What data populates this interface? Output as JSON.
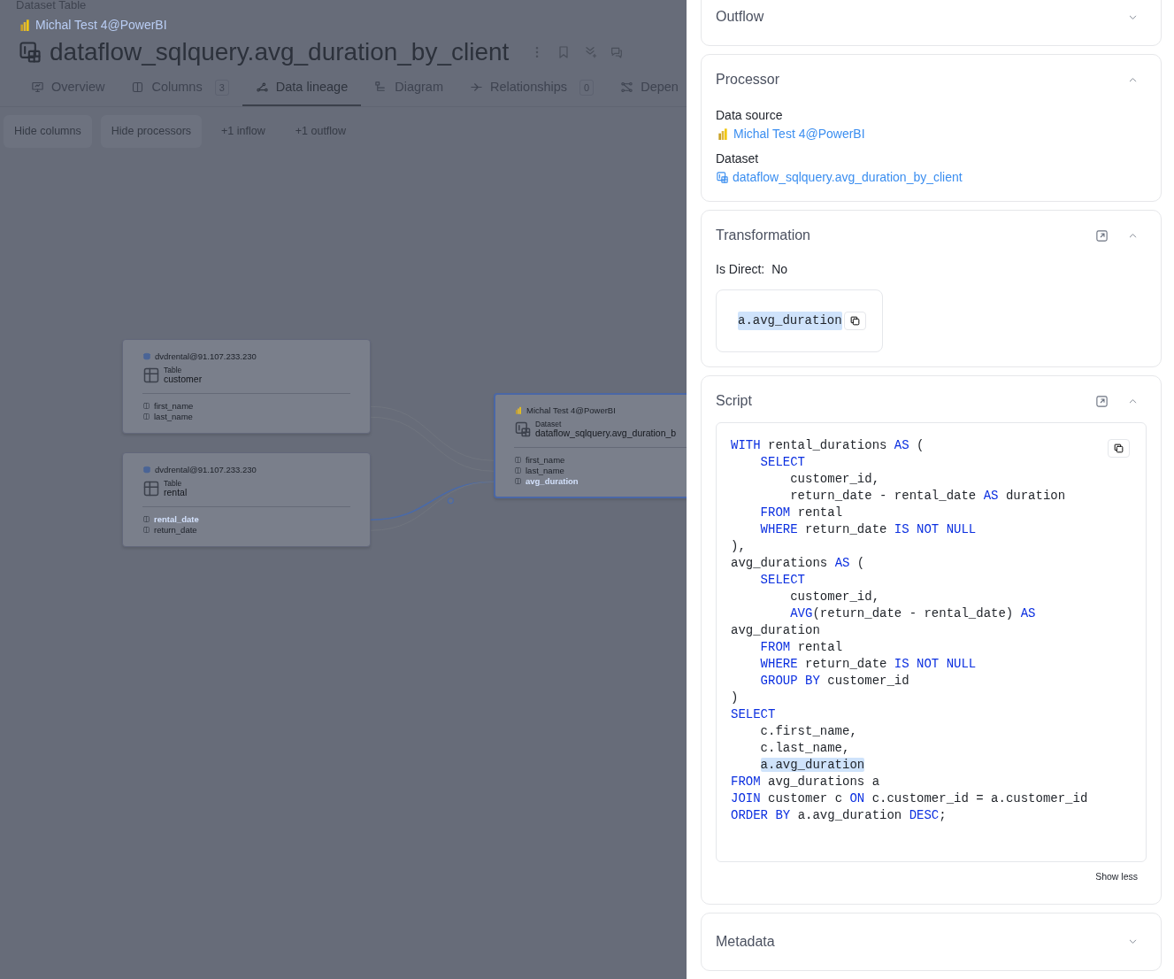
{
  "header": {
    "breadcrumb": "Dataset Table",
    "source": "Michal Test 4@PowerBI",
    "title": "dataflow_sqlquery.avg_duration_by_client"
  },
  "tabs": [
    {
      "label": "Overview",
      "selected": false
    },
    {
      "label": "Columns",
      "count": "3",
      "selected": false
    },
    {
      "label": "Data lineage",
      "selected": true
    },
    {
      "label": "Diagram",
      "selected": false
    },
    {
      "label": "Relationships",
      "count": "0",
      "selected": false
    },
    {
      "label": "Depen",
      "selected": false
    }
  ],
  "toolbar_buttons": [
    "Hide columns",
    "Hide processors",
    "+1 inflow",
    "+1 outflow"
  ],
  "lineage": {
    "nodes": [
      {
        "kind": "table",
        "source": "dvdrental@91.107.233.230",
        "type": "Table",
        "name": "customer",
        "selected": false,
        "columns": [
          {
            "name": "first_name",
            "highlighted": false
          },
          {
            "name": "last_name",
            "highlighted": false
          }
        ]
      },
      {
        "kind": "table",
        "source": "dvdrental@91.107.233.230",
        "type": "Table",
        "name": "rental",
        "selected": false,
        "columns": [
          {
            "name": "rental_date",
            "highlighted": true
          },
          {
            "name": "return_date",
            "highlighted": false
          }
        ]
      },
      {
        "kind": "dataset",
        "source": "Michal Test 4@PowerBI",
        "type": "Dataset",
        "name": "dataflow_sqlquery.avg_duration_b",
        "selected": true,
        "columns": [
          {
            "name": "first_name",
            "highlighted": false
          },
          {
            "name": "last_name",
            "highlighted": false
          },
          {
            "name": "avg_duration",
            "highlighted": true
          }
        ]
      }
    ]
  },
  "panel": {
    "sections": [
      {
        "kind": "plain",
        "title": "Outflow",
        "expanded": false
      },
      {
        "kind": "processor",
        "title": "Processor",
        "expanded": true,
        "fields": [
          {
            "label": "Data source",
            "value": "Michal Test 4@PowerBI",
            "kind": "source"
          },
          {
            "label": "Dataset",
            "value": "dataflow_sqlquery.avg_duration_by_client",
            "kind": "dataset"
          }
        ]
      },
      {
        "kind": "transformation",
        "title": "Transformation",
        "expanded": true,
        "is_direct_label": "Is Direct:",
        "is_direct_value": "No",
        "expression": "a.avg_duration",
        "expression_selected": true
      },
      {
        "kind": "script",
        "title": "Script",
        "expanded": true,
        "toggle": "Show less",
        "lines": [
          [
            {
              "text": "WITH",
              "kind": "keyword"
            },
            {
              "text": " rental_durations ",
              "kind": "plain"
            },
            {
              "text": "AS",
              "kind": "keyword"
            },
            {
              "text": " (",
              "kind": "plain"
            }
          ],
          [
            {
              "text": "    SELECT",
              "kind": "keyword"
            }
          ],
          [
            {
              "text": "        customer_id,",
              "kind": "plain"
            }
          ],
          [
            {
              "text": "        return_date - rental_date ",
              "kind": "plain"
            },
            {
              "text": "AS",
              "kind": "keyword"
            },
            {
              "text": " duration",
              "kind": "plain"
            }
          ],
          [
            {
              "text": "    FROM",
              "kind": "keyword"
            },
            {
              "text": " rental",
              "kind": "plain"
            }
          ],
          [
            {
              "text": "    WHERE",
              "kind": "keyword"
            },
            {
              "text": " return_date ",
              "kind": "plain"
            },
            {
              "text": "IS NOT NULL",
              "kind": "keyword"
            }
          ],
          [
            {
              "text": "),",
              "kind": "plain"
            }
          ],
          [
            {
              "text": "avg_durations ",
              "kind": "plain"
            },
            {
              "text": "AS",
              "kind": "keyword"
            },
            {
              "text": " (",
              "kind": "plain"
            }
          ],
          [
            {
              "text": "    SELECT",
              "kind": "keyword"
            }
          ],
          [
            {
              "text": "        customer_id,",
              "kind": "plain"
            }
          ],
          [
            {
              "text": "        AVG",
              "kind": "keyword"
            },
            {
              "text": "(return_date - rental_date) ",
              "kind": "plain"
            },
            {
              "text": "AS",
              "kind": "keyword"
            }
          ],
          [
            {
              "text": "avg_duration",
              "kind": "plain"
            }
          ],
          [
            {
              "text": "    FROM",
              "kind": "keyword"
            },
            {
              "text": " rental",
              "kind": "plain"
            }
          ],
          [
            {
              "text": "    WHERE",
              "kind": "keyword"
            },
            {
              "text": " return_date ",
              "kind": "plain"
            },
            {
              "text": "IS NOT NULL",
              "kind": "keyword"
            }
          ],
          [
            {
              "text": "    GROUP BY",
              "kind": "keyword"
            },
            {
              "text": " customer_id",
              "kind": "plain"
            }
          ],
          [
            {
              "text": ")",
              "kind": "plain"
            }
          ],
          [
            {
              "text": "SELECT",
              "kind": "keyword"
            }
          ],
          [
            {
              "text": "    c.first_name,",
              "kind": "plain"
            }
          ],
          [
            {
              "text": "    c.last_name,",
              "kind": "plain"
            }
          ],
          [
            {
              "text": "    a.avg_duration",
              "kind": "highlight"
            }
          ],
          [
            {
              "text": "FROM",
              "kind": "keyword"
            },
            {
              "text": " avg_durations a",
              "kind": "plain"
            }
          ],
          [
            {
              "text": "JOIN",
              "kind": "keyword"
            },
            {
              "text": " customer c ",
              "kind": "plain"
            },
            {
              "text": "ON",
              "kind": "keyword"
            },
            {
              "text": " c.customer_id = a.customer_id",
              "kind": "plain"
            }
          ],
          [
            {
              "text": "ORDER BY",
              "kind": "keyword"
            },
            {
              "text": " a.avg_duration ",
              "kind": "plain"
            },
            {
              "text": "DESC",
              "kind": "keyword"
            },
            {
              "text": ";",
              "kind": "plain"
            }
          ]
        ]
      },
      {
        "kind": "plain",
        "title": "Metadata",
        "expanded": false
      }
    ]
  }
}
